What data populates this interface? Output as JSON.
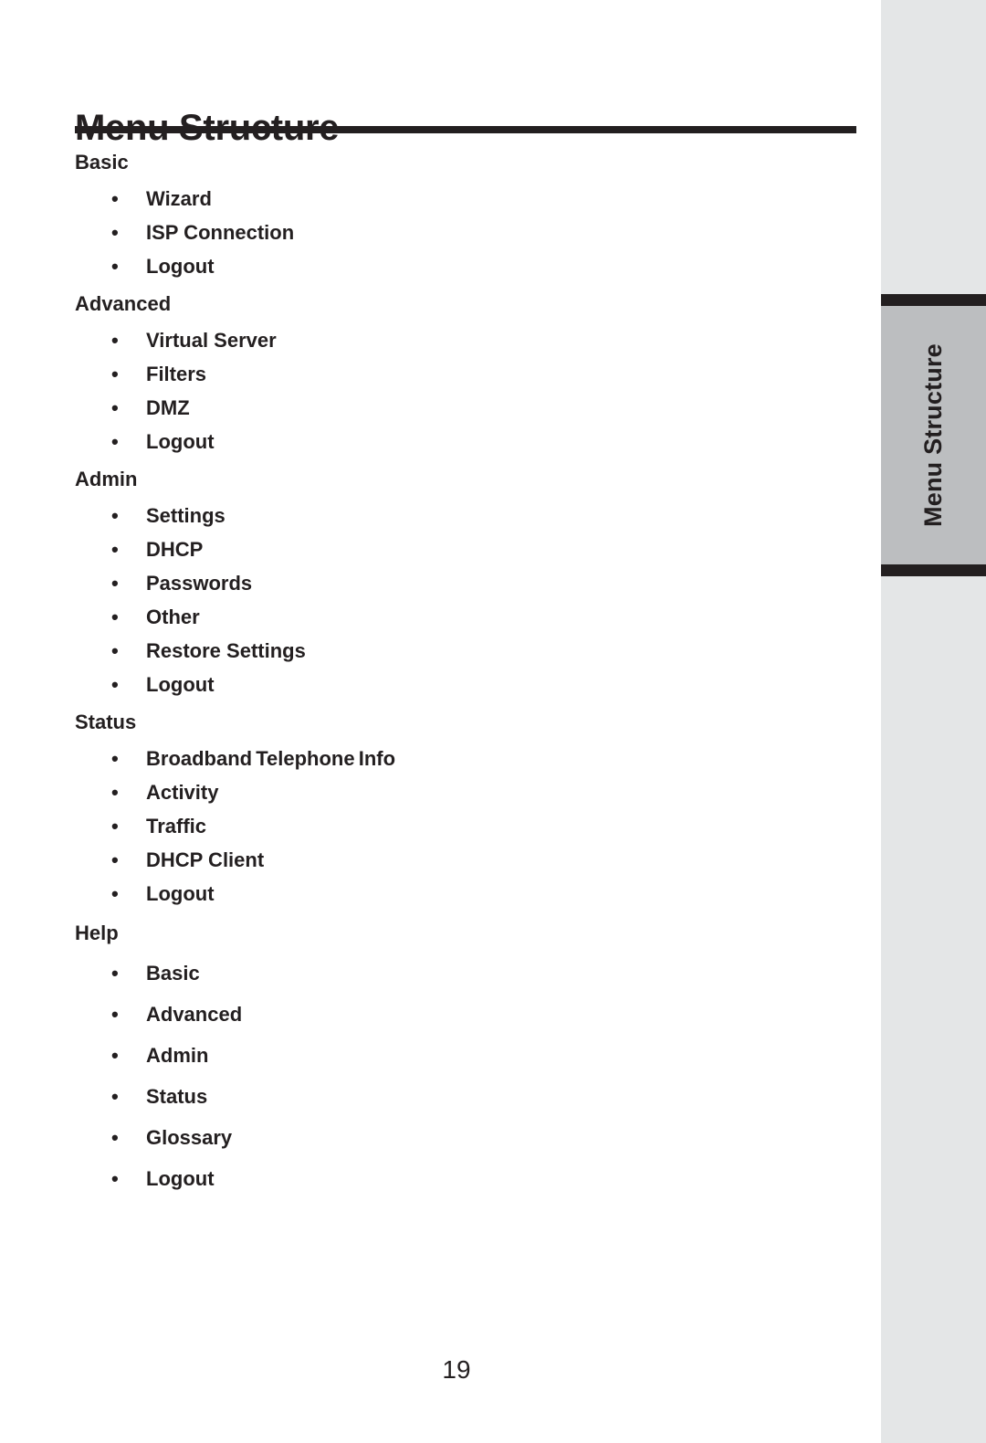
{
  "page": {
    "title": "Menu Structure",
    "number": "19",
    "accent_color": "#231f20",
    "tab_face_color": "#bcbec0",
    "edge_strip_color": "#e4e6e7"
  },
  "chapter_tab": {
    "label": "Menu Structure"
  },
  "menu_sections": [
    {
      "title": "Basic",
      "items": [
        "Wizard",
        "ISP Connection",
        "Logout"
      ]
    },
    {
      "title": "Advanced",
      "items": [
        "Virtual Server",
        "Filters",
        "DMZ",
        "Logout"
      ]
    },
    {
      "title": "Admin",
      "items": [
        "Settings",
        "DHCP",
        "Passwords",
        "Other",
        "Restore Settings",
        "Logout"
      ]
    },
    {
      "title": "Status",
      "items": [
        "Broadband Telephone Info",
        "Activity",
        "Traffic",
        "DHCP Client",
        "Logout"
      ]
    },
    {
      "title": "Help",
      "items": [
        "Basic",
        "Advanced",
        "Admin",
        "Status",
        "Glossary",
        "Logout"
      ]
    }
  ],
  "bullet_glyph": "•"
}
